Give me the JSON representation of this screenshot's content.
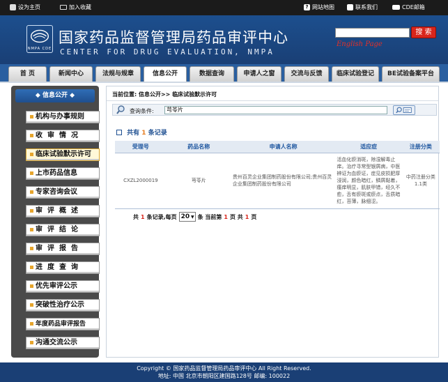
{
  "topbar": {
    "home": "设为主页",
    "favorite": "加入收藏",
    "sitemap": "网站地图",
    "contact": "联系我们",
    "email": "CDE邮箱"
  },
  "banner": {
    "title_cn": "国家药品监督管理局药品审评中心",
    "title_en": "CENTER FOR DRUG EVALUATION, NMPA",
    "logo_abbr": "NMPA CDE",
    "search_button": "搜 索",
    "english_link": "English Page"
  },
  "nav": {
    "tabs": [
      "首 页",
      "新闻中心",
      "法规与规章",
      "信息公开",
      "数据查询",
      "申请人之窗",
      "交流与反馈",
      "临床试验登记",
      "BE试验备案平台"
    ]
  },
  "sidebar": {
    "header": "信息公开",
    "items": [
      "机构与办事规则",
      "收审情况",
      "临床试验默示许可",
      "上市药品信息",
      "专家咨询会议",
      "审评概述",
      "审评结论",
      "审评报告",
      "进度查询",
      "优先审评公示",
      "突破性治疗公示",
      "年度药品审评报告",
      "沟通交流公示"
    ]
  },
  "main": {
    "breadcrumb": "当前位置: 信息公开>> 临床试验默示许可",
    "query_label": "查询条件:",
    "query_value": "芎苓片",
    "count_prefix": "共有",
    "count_value": "1",
    "count_suffix": "条记录",
    "table": {
      "headers": [
        "受理号",
        "药品名称",
        "申请人名称",
        "适应症",
        "注册分类"
      ],
      "rows": [
        {
          "id": "CXZL2000019",
          "drug": "芎苓片",
          "applicant": "贵州百灵企业集团制药股份有限公司;贵州百灵企业集团制药股份有限公司",
          "indication": "活血化瘀消斑，除湿解毒止痒。治疗寻常型银屑病，中医辨证为血瘀证，症见皮损肥厚浸润，颜色暗红，鳞屑黏着，瘙痒明显，肌肤甲错，经久不愈，舌有瘀斑或瘀点，舌质暗红，苔薄，脉细涩。",
          "category": "中药注册分类1.1类"
        }
      ]
    },
    "pager": {
      "total_prefix": "共",
      "total_value": "1",
      "total_suffix": "条记录,每页",
      "page_size": "20",
      "current_prefix": "条 当前第",
      "current_value": "1",
      "current_suffix": "页 共",
      "pages_value": "1",
      "pages_suffix": "页"
    }
  },
  "footer": {
    "line1": "Copyright © 国家药品监督管理局药品审评中心    All Right Reserved.",
    "line2": "地址: 中国 北京市朝阳区建国路128号    邮编: 100022"
  }
}
